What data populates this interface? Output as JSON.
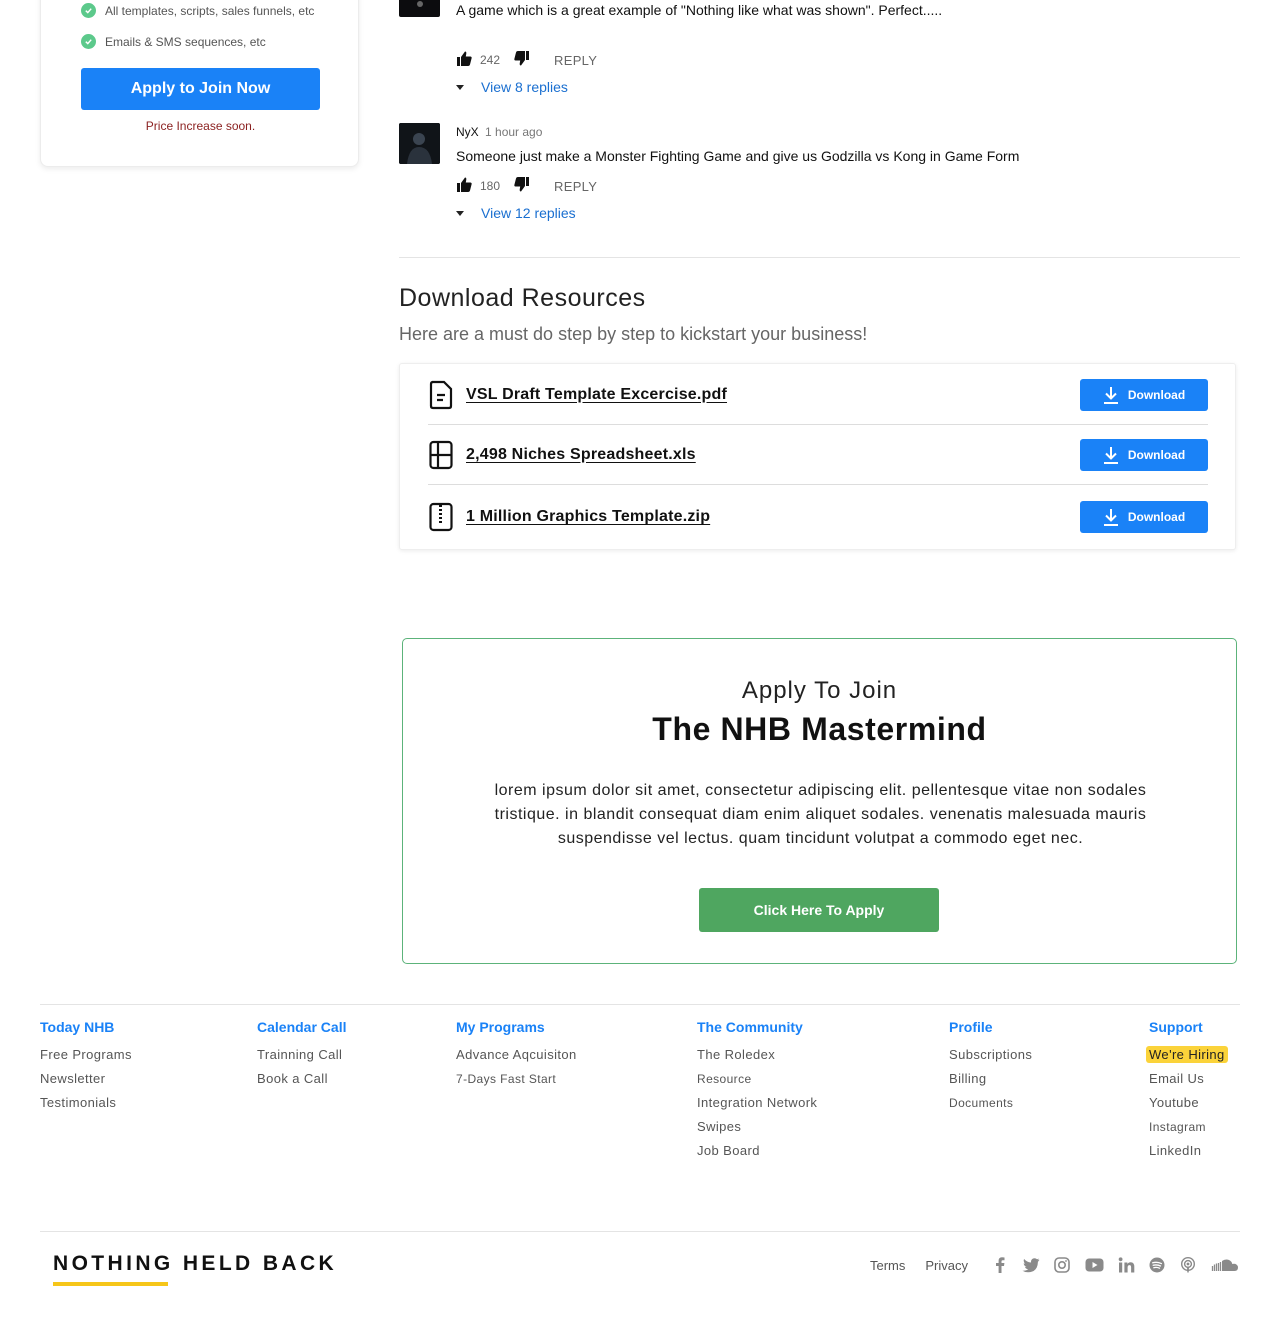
{
  "sidebar": {
    "features": [
      "All templates, scripts, sales funnels, etc",
      "Emails & SMS sequences, etc"
    ],
    "apply_button": "Apply to Join Now",
    "price_note": "Price Increase soon."
  },
  "comments": [
    {
      "text": "A game which is a great example of \"Nothing like what was shown\". Perfect.....",
      "likes": "242",
      "reply_label": "REPLY",
      "view_replies": "View 8 replies"
    },
    {
      "author": "NyX",
      "time": "1 hour ago",
      "text": "Someone just make a Monster Fighting Game and give us Godzilla vs Kong in Game Form",
      "likes": "180",
      "reply_label": "REPLY",
      "view_replies": "View 12 replies"
    }
  ],
  "resources": {
    "title": "Download Resources",
    "subtitle": "Here are a must do step by step to kickstart your business!",
    "files": [
      {
        "name": "VSL Draft Template Excercise.pdf",
        "icon": "document-icon",
        "button": "Download"
      },
      {
        "name": "2,498 Niches Spreadsheet.xls",
        "icon": "spreadsheet-icon",
        "button": "Download"
      },
      {
        "name": "1 Million Graphics Template.zip",
        "icon": "zip-file-icon",
        "button": "Download"
      }
    ]
  },
  "mastermind": {
    "pre_title": "Apply To Join",
    "title": "The NHB Mastermind",
    "body": "lorem ipsum dolor sit amet, consectetur adipiscing elit. pellentesque vitae non sodales tristique. in blandit consequat diam enim aliquet sodales. venenatis malesuada mauris suspendisse vel lectus. quam tincidunt volutpat a commodo eget nec.",
    "button": "Click Here To Apply"
  },
  "footer": {
    "columns": [
      {
        "heading": "Today NHB",
        "links": [
          "Free Programs",
          "Newsletter",
          "Testimonials"
        ]
      },
      {
        "heading": "Calendar Call",
        "links": [
          "Trainning Call",
          "Book a Call"
        ]
      },
      {
        "heading": "My Programs",
        "links": [
          "Advance Aqcuisiton",
          "7-Days Fast Start"
        ]
      },
      {
        "heading": "The Community",
        "links": [
          "The Roledex",
          "Resource",
          "Integration Network",
          "Swipes",
          "Job Board"
        ]
      },
      {
        "heading": "Profile",
        "links": [
          "Subscriptions",
          "Billing",
          "Documents"
        ]
      },
      {
        "heading": "Support",
        "links": [
          "We're Hiring",
          "Email Us",
          "Youtube",
          "Instagram",
          "LinkedIn"
        ]
      }
    ],
    "brand": "NOTHING HELD BACK",
    "brand_accent": "#f6c619",
    "bottom_links": [
      "Terms",
      "Privacy"
    ],
    "social_icons": [
      "facebook-icon",
      "twitter-icon",
      "instagram-icon",
      "youtube-icon",
      "linkedin-icon",
      "spotify-icon",
      "podcast-icon",
      "soundcloud-icon"
    ]
  },
  "colors": {
    "primary_blue": "#1a82f7",
    "green": "#4fa660",
    "link_blue": "#1a6fd0",
    "highlight_yellow": "#fbd33a"
  }
}
